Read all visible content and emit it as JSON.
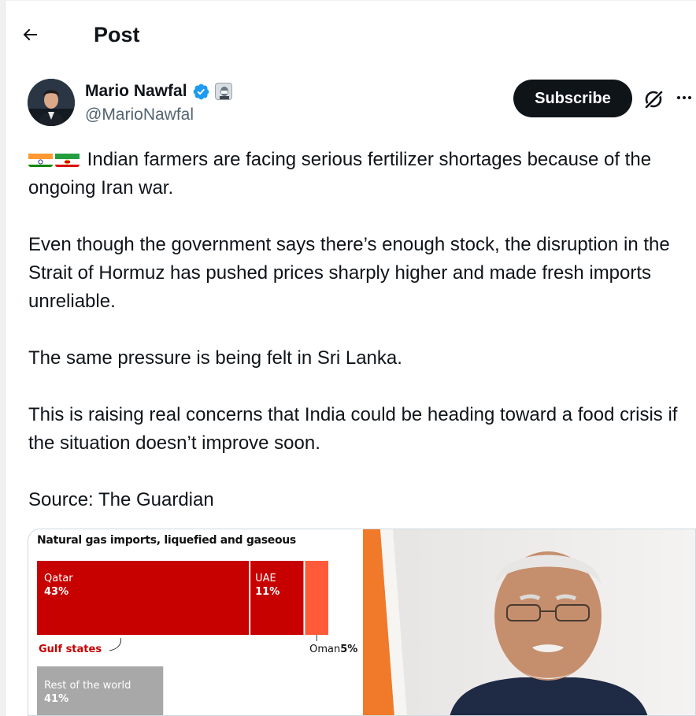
{
  "header": {
    "title": "Post",
    "back_icon": "arrow-left-icon"
  },
  "author": {
    "name": "Mario Nawfal",
    "handle": "@MarioNawfal",
    "verified_icon": "verified-badge-icon",
    "affiliate_icon": "affiliate-badge-icon"
  },
  "actions": {
    "subscribe_label": "Subscribe",
    "grok_icon": "grok-icon",
    "more_icon": "more-icon"
  },
  "post": {
    "paragraphs": [
      "Indian farmers are facing serious fertilizer shortages because of the ongoing Iran war.",
      "Even though the government says there’s enough stock, the disruption in the Strait of Hormuz has pushed prices sharply higher and made fresh imports unreliable.",
      "The same pressure is being felt in Sri Lanka.",
      "This is raising real concerns that India could be heading toward a food crisis if the situation doesn’t improve soon.",
      "Source: The Guardian"
    ],
    "flag_icons": [
      "india-flag-icon",
      "iran-flag-icon"
    ]
  },
  "colors": {
    "accent": "#1d9bf0",
    "gulf_dark": "#c70000",
    "gulf_light": "#ff5b3a",
    "rest": "#a8a8a8",
    "button_bg": "#0f1419"
  },
  "chart_data": {
    "type": "treemap",
    "title": "Natural gas imports, liquefied and gaseous",
    "categories": [
      "Qatar",
      "UAE",
      "Oman",
      "Rest of the world"
    ],
    "values": [
      43,
      11,
      5,
      41
    ],
    "value_labels": [
      "43%",
      "11%",
      "5%",
      "41%"
    ],
    "groups": [
      {
        "name": "Gulf states",
        "members": [
          "Qatar",
          "UAE",
          "Oman"
        ]
      },
      {
        "name": "Rest of the world",
        "members": [
          "Rest of the world"
        ]
      }
    ],
    "group_label": "Gulf states"
  }
}
